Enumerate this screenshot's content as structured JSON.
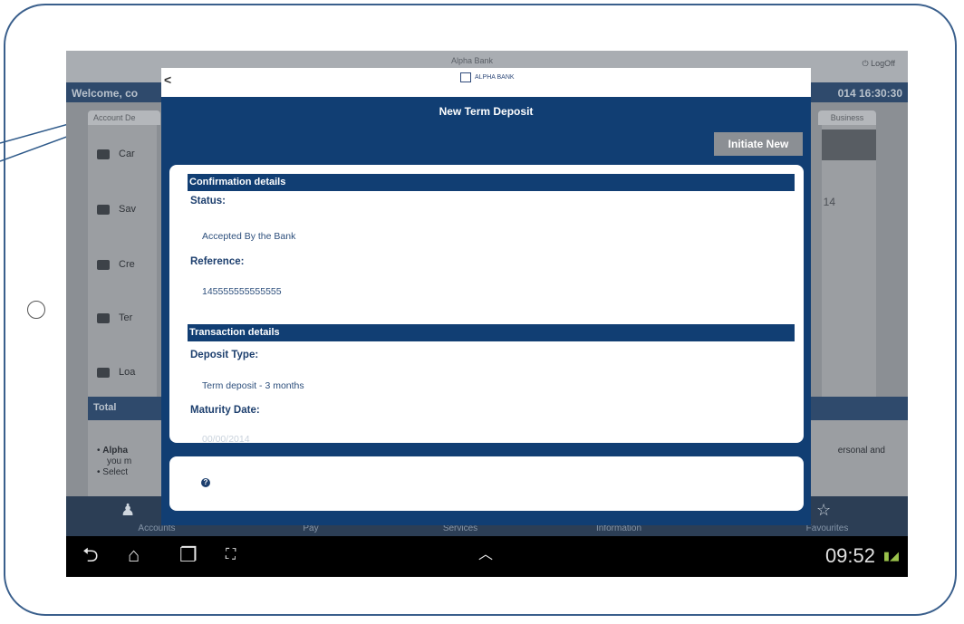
{
  "background_app": {
    "logo_text": "Alpha Bank",
    "logoff_label": "LogOff",
    "welcome_text": "Welcome, co",
    "datetime": "014 16:30:30",
    "tab_left": "Account De",
    "tab_right": "Business",
    "right_date_fragment": "14",
    "menu_items": [
      {
        "label": "Car",
        "icon": "card-icon"
      },
      {
        "label": "Sav",
        "icon": "piggy-icon"
      },
      {
        "label": "Cre",
        "icon": "folder-icon"
      },
      {
        "label": "Ter",
        "icon": "document-icon"
      },
      {
        "label": "Loa",
        "icon": "calendar-icon"
      }
    ],
    "total_label": "Total",
    "notes": [
      "Alpha",
      "you m",
      "Select"
    ],
    "note_right": "ersonal and"
  },
  "bottom_nav": {
    "items": [
      "Accounts",
      "Pay",
      "Services",
      "Information",
      "Favourites"
    ]
  },
  "system_bar": {
    "time": "09:52"
  },
  "dialog": {
    "back_icon": "chevron-left-icon",
    "logo_text": "ALPHA BANK",
    "title": "New Term Deposit",
    "initiate_label": "Initiate New",
    "confirmation_header": "Confirmation details",
    "status_label": "Status:",
    "status_value": "Accepted By the Bank",
    "reference_label": "Reference:",
    "reference_value": "145555555555555",
    "transaction_header": "Transaction details",
    "deposit_type_label": "Deposit Type:",
    "deposit_type_value": "Term deposit - 3 months",
    "maturity_label": "Maturity Date:",
    "maturity_value": "00/00/2014",
    "help_icon": "help-icon"
  }
}
